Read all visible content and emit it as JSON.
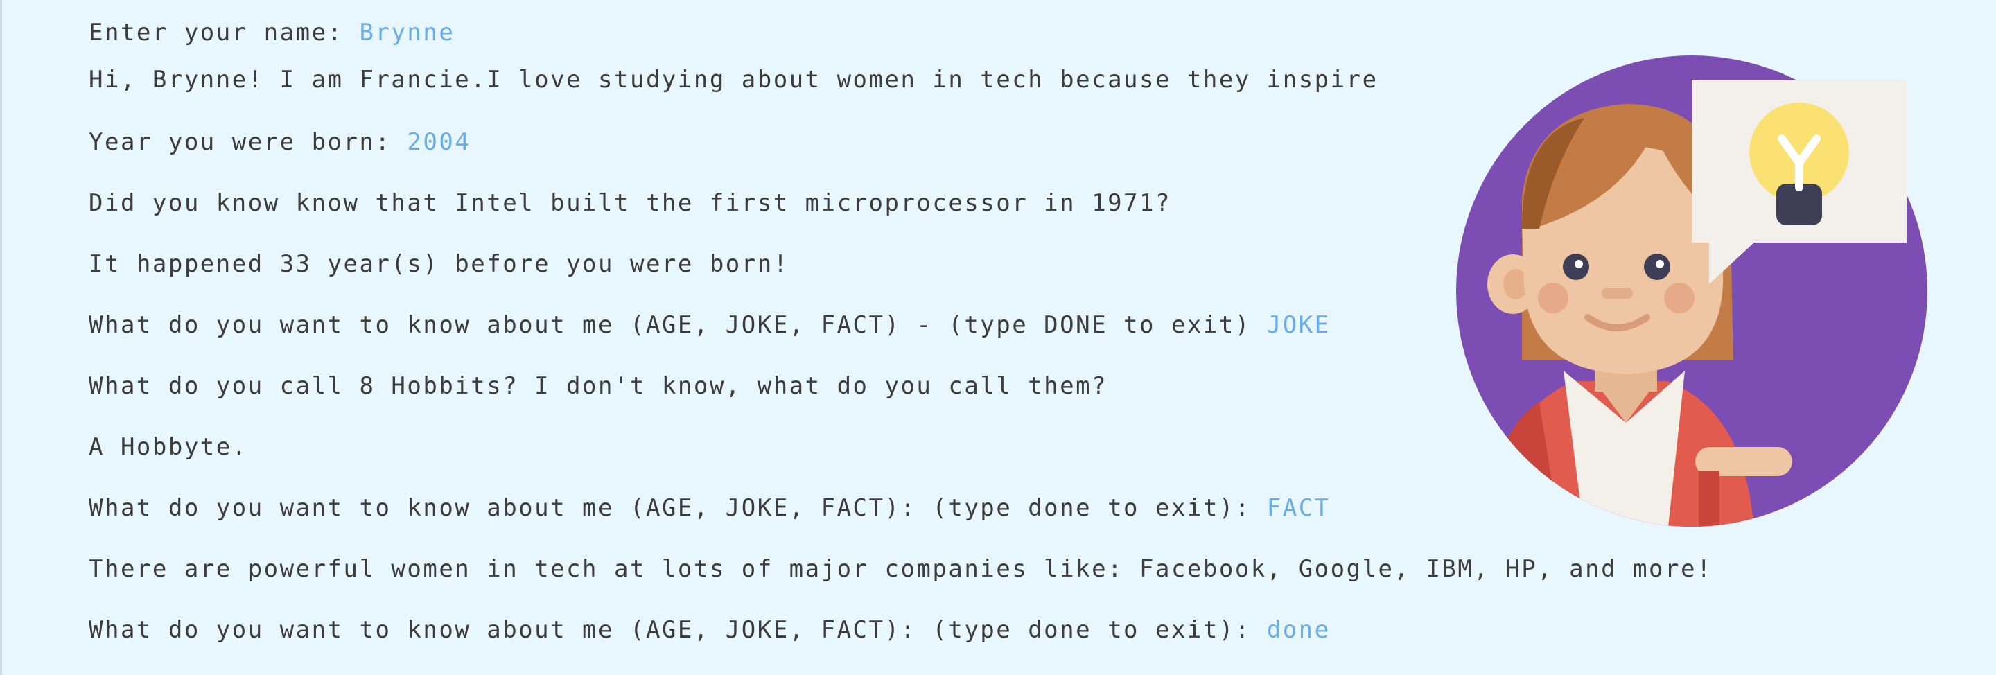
{
  "console": {
    "lines": [
      {
        "prompt": "Enter your name: ",
        "input": "Brynne"
      },
      {
        "text": "Hi, Brynne! I am Francie.I love studying about women in tech because they inspire"
      },
      {
        "prompt": "Year you were born: ",
        "input": "2004"
      },
      {
        "text": "Did you know know that Intel built the first microprocessor in 1971?"
      },
      {
        "text": "It happened 33 year(s) before you were born!"
      },
      {
        "prompt": "What do you want to know about me (AGE, JOKE, FACT) - (type DONE to exit) ",
        "input": "JOKE"
      },
      {
        "text": "What do you call 8 Hobbits? I don't know, what do you call them?"
      },
      {
        "text": "A Hobbyte."
      },
      {
        "prompt": "What do you want to know about me (AGE, JOKE, FACT): (type done to exit): ",
        "input": "FACT"
      },
      {
        "text": "There are powerful women in tech at lots of major companies like: Facebook, Google, IBM, HP, and more!"
      },
      {
        "prompt": "What do you want to know about me (AGE, JOKE, FACT): (type done to exit): ",
        "input": "done"
      }
    ]
  },
  "colors": {
    "background": "#e8f6fd",
    "text": "#3c3c3c",
    "input": "#6aaee9",
    "avatar_circle": "#7c4db3"
  },
  "avatar": {
    "icon": "woman-with-lightbulb-idea-icon"
  }
}
